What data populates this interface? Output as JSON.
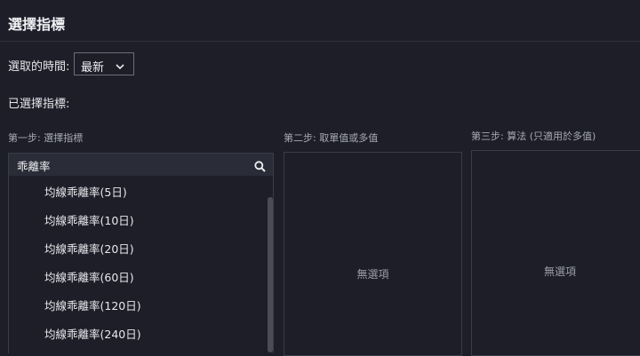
{
  "dialog": {
    "title": "選擇指標"
  },
  "time": {
    "label": "選取的時間:",
    "selected": "最新"
  },
  "selected_indicators": {
    "label": "已選擇指標:"
  },
  "steps": {
    "step1": "第一步: 選擇指標",
    "step2": "第二步: 取單值或多值",
    "step3": "第三步: 算法 (只適用於多值)"
  },
  "search": {
    "value": "乖離率",
    "icon": "search-icon"
  },
  "indicator_list": [
    "均線乖離率(5日)",
    "均線乖離率(10日)",
    "均線乖離率(20日)",
    "均線乖離率(60日)",
    "均線乖離率(120日)",
    "均線乖離率(240日)"
  ],
  "panel2": {
    "empty_text": "無選項"
  },
  "panel3": {
    "empty_text": "無選項"
  }
}
